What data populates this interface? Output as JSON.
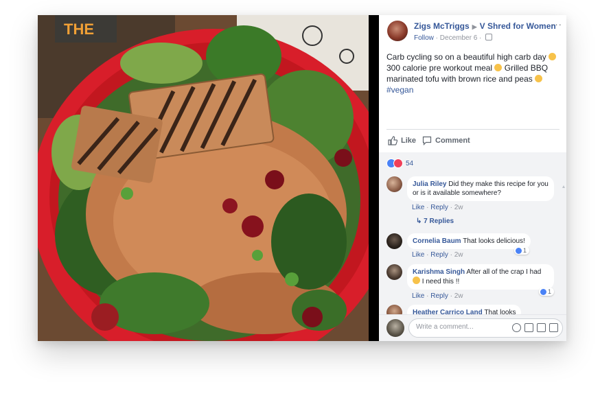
{
  "post": {
    "author": "Zigs McTriggs",
    "group": "V Shred for Women",
    "follow_label": "Follow",
    "date": "December 6",
    "caption_line1": "Carb cycling so on a beautiful high carb day",
    "caption_line2": "300 calorie pre workout meal",
    "caption_line3": "Grilled BBQ marinated tofu with brown rice and peas",
    "hashtag": "#vegan",
    "more_label": "···",
    "photo_label": "THE"
  },
  "actions": {
    "like_label": "Like",
    "comment_label": "Comment"
  },
  "reactions": {
    "count": "54"
  },
  "comments": [
    {
      "name": "Julia Riley",
      "text": "Did they make this recipe for you or is it available somewhere?",
      "like": "Like",
      "reply": "Reply",
      "time": "2w",
      "replies": "7 Replies"
    },
    {
      "name": "Cornelia Baum",
      "text": "That looks delicious!",
      "like": "Like",
      "reply": "Reply",
      "time": "2w",
      "reaction_count": "1"
    },
    {
      "name": "Karishma Singh",
      "text": "After all of the crap I had",
      "text2": "I need this !!",
      "like": "Like",
      "reply": "Reply",
      "time": "2w",
      "reaction_count": "1"
    },
    {
      "name": "Heather Carrico Land",
      "text": "That looks"
    }
  ],
  "composer": {
    "placeholder": "Write a comment..."
  },
  "colors": {
    "link": "#365899",
    "muted": "#90949c",
    "bowl": "#d81e2a",
    "like_blue": "#4a82f6",
    "love_red": "#f0405a"
  }
}
